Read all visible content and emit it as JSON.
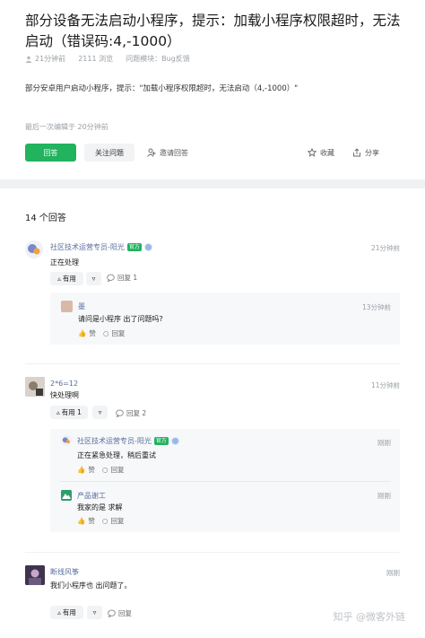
{
  "question": {
    "title": "部分设备无法启动小程序，提示：加载小程序权限超时，无法启动（错误码:4,-1000）",
    "author_time": "21分钟前",
    "views": "2111 浏览",
    "module": "问题模块：Bug反馈",
    "description": "部分安卓用户启动小程序，提示：\"加载小程序权限超时，无法启动（4,-1000）\"",
    "edited": "最后一次编辑于  20分钟前",
    "actions": {
      "answer": "回答",
      "follow": "关注问题",
      "invite": "邀请回答",
      "collect": "收藏",
      "share": "分享"
    }
  },
  "answers_count": "14 个回答",
  "answers": [
    {
      "user": "社区技术运营专员-阳光",
      "badge": "官方",
      "time": "21分钟前",
      "content": "正在处理",
      "useful": "有用",
      "reply": "回复 1",
      "replies": [
        {
          "user": "墨",
          "time": "13分钟前",
          "content": "请问是小程序 出了问题吗?",
          "like": "赞",
          "reply": "回复"
        }
      ]
    },
    {
      "user": "2*6=12",
      "time": "11分钟前",
      "content": "快处理啊",
      "useful": "有用 1",
      "reply": "回复 2",
      "replies": [
        {
          "user": "社区技术运营专员-阳光",
          "badge": "官方",
          "time": "刚刚",
          "content": "正在紧急处理，稍后重试",
          "like": "赞",
          "reply": "回复"
        },
        {
          "user": "产品谢工",
          "time": "刚刚",
          "content": "我家的是 求解",
          "like": "赞",
          "reply": "回复"
        }
      ]
    },
    {
      "user": "断线风筝",
      "time": "刚刚",
      "content": "我们小程序也 出问题了。",
      "useful": "有用",
      "reply": "回复"
    }
  ],
  "watermark": "知乎 @微客外链",
  "colors": {
    "primary": "#21b35e",
    "link": "#5a6f9e",
    "muted": "#9aa0a6"
  }
}
